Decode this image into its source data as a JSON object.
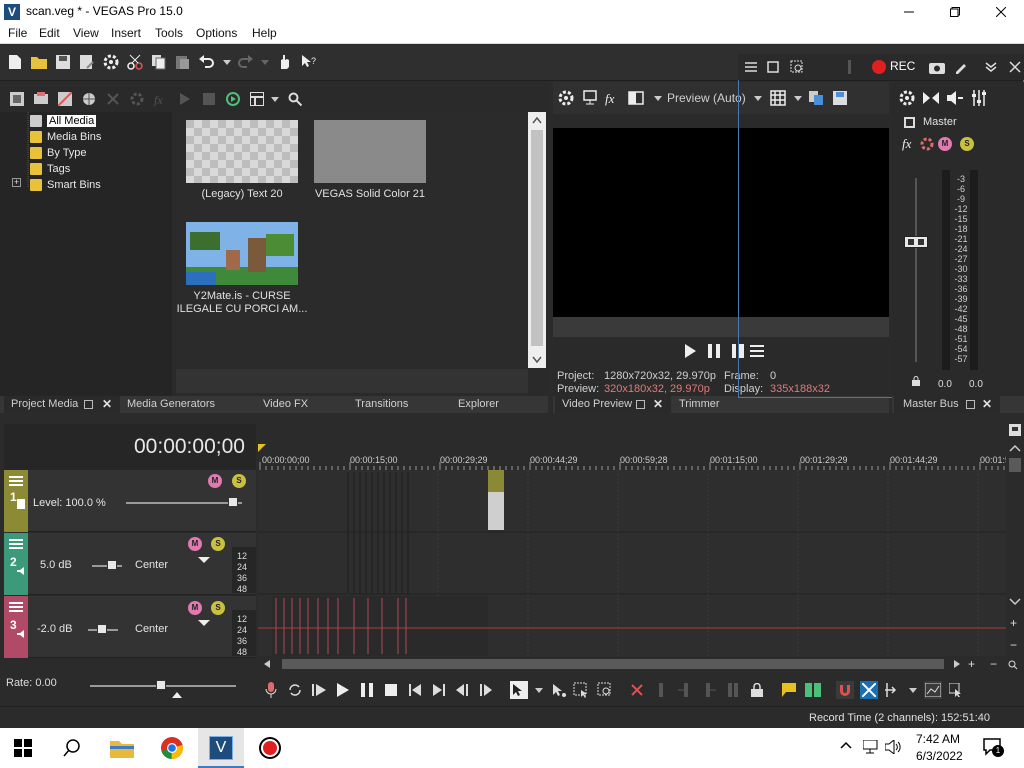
{
  "window": {
    "title": "scan.veg * - VEGAS Pro 15.0",
    "logo": "V",
    "controls": [
      "minimize-icon",
      "maximize-icon",
      "close-icon"
    ]
  },
  "menu": [
    "File",
    "Edit",
    "View",
    "Insert",
    "Tools",
    "Options",
    "Help"
  ],
  "recorder": {
    "rec_label": "REC"
  },
  "project_media": {
    "tree": [
      "All Media",
      "Media Bins",
      "By Type",
      "Tags",
      "Smart Bins"
    ],
    "expand_toggle": "+",
    "items": [
      {
        "label": "(Legacy) Text 20"
      },
      {
        "label": "VEGAS Solid Color 21"
      },
      {
        "label": "Y2Mate.is - CURSE ILEGALE CU PORCI AM..."
      }
    ]
  },
  "dock_tabs": {
    "project_media": "Project Media",
    "media_generators": "Media Generators",
    "video_fx": "Video FX",
    "transitions": "Transitions",
    "explorer": "Explorer",
    "video_preview": "Video Preview",
    "trimmer": "Trimmer",
    "master_bus": "Master Bus"
  },
  "preview": {
    "mode": "Preview (Auto)",
    "fx_label": "fx",
    "project_label": "Project:",
    "project_value": "1280x720x32, 29.970p",
    "preview_label": "Preview:",
    "preview_value": "320x180x32, 29.970p",
    "frame_label": "Frame:",
    "frame_value": "0",
    "display_label": "Display:",
    "display_value": "335x188x32",
    "accent_color": "#e07a7a"
  },
  "master": {
    "label": "Master",
    "fx_label": "fx",
    "scale": [
      "-3",
      "-6",
      "-9",
      "-12",
      "-15",
      "-18",
      "-21",
      "-24",
      "-27",
      "-30",
      "-33",
      "-36",
      "-39",
      "-42",
      "-45",
      "-48",
      "-51",
      "-54",
      "-57"
    ],
    "peak_left": "0.0",
    "peak_right": "0.0"
  },
  "timeline": {
    "timecode": "00:00:00;00",
    "ruler": [
      "00:00:00;00",
      "00:00:15;00",
      "00:00:29;29",
      "00:00:44;29",
      "00:00:59;28",
      "00:01:15;00",
      "00:01:29;29",
      "00:01:44;29",
      "00:01:5"
    ],
    "tracks": [
      {
        "number": "1",
        "level": "Level: 100.0 %",
        "color": "#8c8a34"
      },
      {
        "number": "2",
        "volume": "5.0 dB",
        "pan": "Center",
        "color": "#3c9a7a"
      },
      {
        "number": "3",
        "volume": "-2.0 dB",
        "pan": "Center",
        "color": "#b04a66"
      }
    ],
    "meter_scale": [
      "12",
      "24",
      "36",
      "48"
    ],
    "rate": "Rate: 0.00",
    "mute_label": "M",
    "solo_label": "S"
  },
  "status": {
    "record_time": "Record Time (2 channels): 152:51:40"
  },
  "taskbar": {
    "time": "7:42 AM",
    "date": "6/3/2022",
    "notification_count": "1",
    "app_letter": "V"
  }
}
